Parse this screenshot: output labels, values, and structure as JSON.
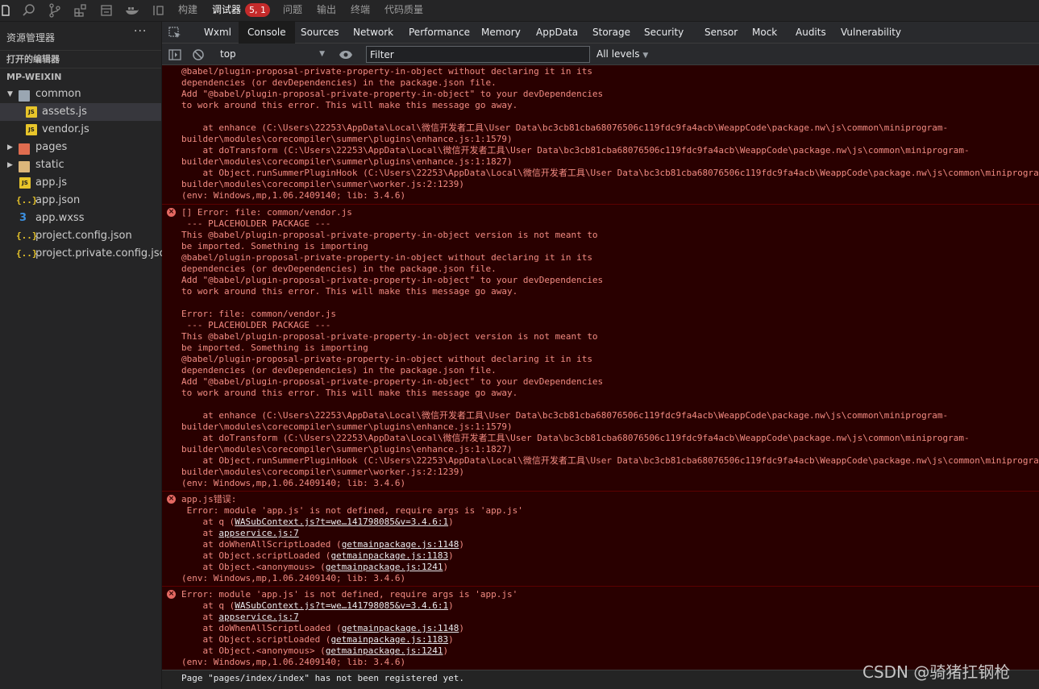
{
  "topbar": {
    "tabs": [
      {
        "label": "构建"
      },
      {
        "label": "调试器"
      },
      {
        "label": "问题"
      },
      {
        "label": "输出"
      },
      {
        "label": "终端"
      },
      {
        "label": "代码质量"
      }
    ],
    "badge": "5, 1"
  },
  "sidebar": {
    "title": "资源管理器",
    "more": "···",
    "open_editors": "打开的编辑器",
    "project": "MP-WEIXIN",
    "tree": [
      {
        "label": "common",
        "type": "folder-open"
      },
      {
        "label": "assets.js",
        "type": "js"
      },
      {
        "label": "vendor.js",
        "type": "js"
      },
      {
        "label": "pages",
        "type": "folder"
      },
      {
        "label": "static",
        "type": "folder"
      },
      {
        "label": "app.js",
        "type": "js"
      },
      {
        "label": "app.json",
        "type": "json"
      },
      {
        "label": "app.wxss",
        "type": "wxss"
      },
      {
        "label": "project.config.json",
        "type": "json"
      },
      {
        "label": "project.private.config.json",
        "type": "json"
      }
    ],
    "icon_labels": {
      "js": "JS",
      "json": "{..}",
      "wxss": "3"
    }
  },
  "devtools": {
    "tabs": [
      "Wxml",
      "Console",
      "Sources",
      "Network",
      "Performance",
      "Memory",
      "AppData",
      "Storage",
      "Security",
      "Sensor",
      "Mock",
      "Audits",
      "Vulnerability"
    ],
    "active_tab": "Console",
    "context": "top",
    "filter_placeholder": "Filter",
    "levels": "All levels"
  },
  "console": {
    "msg1": {
      "lines": [
        "@babel/plugin-proposal-private-property-in-object without declaring it in its",
        "dependencies (or devDependencies) in the package.json file.",
        "Add \"@babel/plugin-proposal-private-property-in-object\" to your devDependencies",
        "to work around this error. This will make this message go away.",
        "",
        "    at enhance (C:\\Users\\22253\\AppData\\Local\\微信开发者工具\\User Data\\bc3cb81cba68076506c119fdc9fa4acb\\WeappCode\\package.nw\\js\\common\\miniprogram-",
        "builder\\modules\\corecompiler\\summer\\plugins\\enhance.js:1:1579)",
        "    at doTransform (C:\\Users\\22253\\AppData\\Local\\微信开发者工具\\User Data\\bc3cb81cba68076506c119fdc9fa4acb\\WeappCode\\package.nw\\js\\common\\miniprogram-",
        "builder\\modules\\corecompiler\\summer\\plugins\\enhance.js:1:1827)",
        "    at Object.runSummerPluginHook (C:\\Users\\22253\\AppData\\Local\\微信开发者工具\\User Data\\bc3cb81cba68076506c119fdc9fa4acb\\WeappCode\\package.nw\\js\\common\\miniprogra",
        "builder\\modules\\corecompiler\\summer\\worker.js:2:1239)",
        "(env: Windows,mp,1.06.2409140; lib: 3.4.6)"
      ]
    },
    "msg2": {
      "lines": [
        "[] Error: file: common/vendor.js",
        " --- PLACEHOLDER PACKAGE ---",
        "This @babel/plugin-proposal-private-property-in-object version is not meant to",
        "be imported. Something is importing",
        "@babel/plugin-proposal-private-property-in-object without declaring it in its",
        "dependencies (or devDependencies) in the package.json file.",
        "Add \"@babel/plugin-proposal-private-property-in-object\" to your devDependencies",
        "to work around this error. This will make this message go away.",
        "",
        "Error: file: common/vendor.js",
        " --- PLACEHOLDER PACKAGE ---",
        "This @babel/plugin-proposal-private-property-in-object version is not meant to",
        "be imported. Something is importing",
        "@babel/plugin-proposal-private-property-in-object without declaring it in its",
        "dependencies (or devDependencies) in the package.json file.",
        "Add \"@babel/plugin-proposal-private-property-in-object\" to your devDependencies",
        "to work around this error. This will make this message go away.",
        "",
        "    at enhance (C:\\Users\\22253\\AppData\\Local\\微信开发者工具\\User Data\\bc3cb81cba68076506c119fdc9fa4acb\\WeappCode\\package.nw\\js\\common\\miniprogram-",
        "builder\\modules\\corecompiler\\summer\\plugins\\enhance.js:1:1579)",
        "    at doTransform (C:\\Users\\22253\\AppData\\Local\\微信开发者工具\\User Data\\bc3cb81cba68076506c119fdc9fa4acb\\WeappCode\\package.nw\\js\\common\\miniprogram-",
        "builder\\modules\\corecompiler\\summer\\plugins\\enhance.js:1:1827)",
        "    at Object.runSummerPluginHook (C:\\Users\\22253\\AppData\\Local\\微信开发者工具\\User Data\\bc3cb81cba68076506c119fdc9fa4acb\\WeappCode\\package.nw\\js\\common\\miniprogra",
        "builder\\modules\\corecompiler\\summer\\worker.js:2:1239)",
        "(env: Windows,mp,1.06.2409140; lib: 3.4.6)"
      ]
    },
    "msg3": {
      "head": [
        "app.js错误:",
        " Error: module 'app.js' is not defined, require args is 'app.js'"
      ],
      "stack": [
        {
          "pre": "    at q (",
          "link": "WASubContext.js?t=we…141798085&v=3.4.6:1",
          "post": ")"
        },
        {
          "pre": "    at ",
          "link": "appservice.js:7",
          "post": ""
        },
        {
          "pre": "    at doWhenAllScriptLoaded (",
          "link": "getmainpackage.js:1148",
          "post": ")"
        },
        {
          "pre": "    at Object.scriptLoaded (",
          "link": "getmainpackage.js:1183",
          "post": ")"
        },
        {
          "pre": "    at Object.<anonymous> (",
          "link": "getmainpackage.js:1241",
          "post": ")"
        }
      ],
      "env": "(env: Windows,mp,1.06.2409140; lib: 3.4.6)"
    },
    "msg4": {
      "head": [
        "Error: module 'app.js' is not defined, require args is 'app.js'"
      ],
      "stack": [
        {
          "pre": "    at q (",
          "link": "WASubContext.js?t=we…141798085&v=3.4.6:1",
          "post": ")"
        },
        {
          "pre": "    at ",
          "link": "appservice.js:7",
          "post": ""
        },
        {
          "pre": "    at doWhenAllScriptLoaded (",
          "link": "getmainpackage.js:1148",
          "post": ")"
        },
        {
          "pre": "    at Object.scriptLoaded (",
          "link": "getmainpackage.js:1183",
          "post": ")"
        },
        {
          "pre": "    at Object.<anonymous> (",
          "link": "getmainpackage.js:1241",
          "post": ")"
        }
      ],
      "env": "(env: Windows,mp,1.06.2409140; lib: 3.4.6)"
    },
    "last": "Page \"pages/index/index\" has not been registered yet.",
    "error_glyph": "×"
  },
  "watermark": "CSDN @骑猪扛钢枪",
  "colors": {
    "error_bg": "#290000",
    "error_text": "#f28b82",
    "badge": "#c42b2b",
    "folder": "#dcb67a",
    "folder_pages": "#e06c4f",
    "folder_static": "#dcb67a"
  }
}
